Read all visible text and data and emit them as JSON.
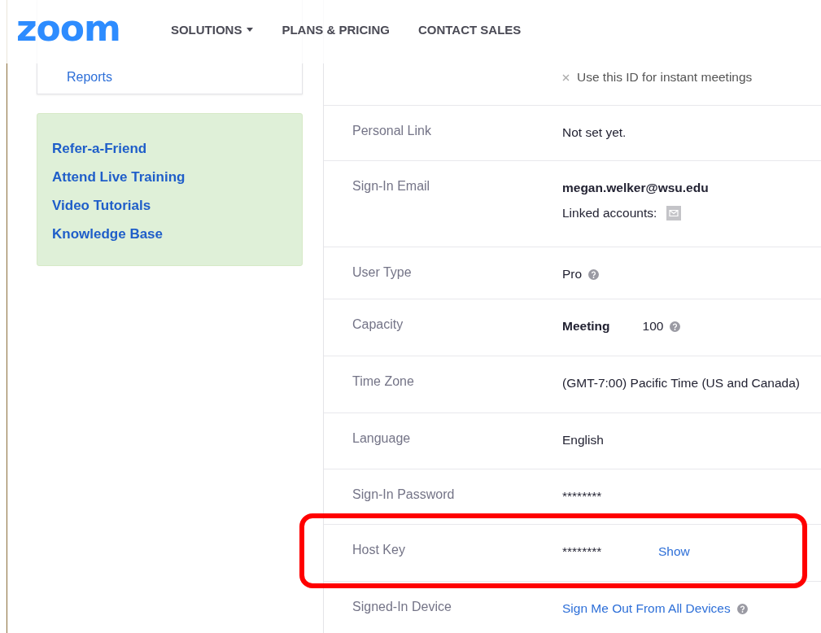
{
  "header": {
    "logo": "zoom",
    "nav": [
      {
        "label": "SOLUTIONS",
        "dropdown": true
      },
      {
        "label": "PLANS & PRICING",
        "dropdown": false
      },
      {
        "label": "CONTACT SALES",
        "dropdown": false
      }
    ]
  },
  "sidebar": {
    "items": [
      "Reports"
    ],
    "help_links": [
      "Refer-a-Friend",
      "Attend Live Training",
      "Video Tutorials",
      "Knowledge Base"
    ]
  },
  "profile_rows": [
    {
      "kind": "option",
      "option": {
        "label": "Use this ID for instant meetings",
        "checked": false
      },
      "highlighted": false
    },
    {
      "kind": "text",
      "label": "Personal Link",
      "value": "Not set yet.",
      "help": false,
      "highlighted": false
    },
    {
      "kind": "email",
      "label": "Sign-In Email",
      "value": "megan.welker@wsu.edu",
      "linked_label": "Linked accounts:",
      "highlighted": false
    },
    {
      "kind": "text",
      "label": "User Type",
      "value": "Pro",
      "help": true,
      "highlighted": false
    },
    {
      "kind": "capacity",
      "label": "Capacity",
      "name": "Meeting",
      "value": "100",
      "help": true,
      "highlighted": false
    },
    {
      "kind": "text",
      "label": "Time Zone",
      "value": "(GMT-7:00) Pacific Time (US and Canada)",
      "help": false,
      "highlighted": false
    },
    {
      "kind": "text",
      "label": "Language",
      "value": "English",
      "help": false,
      "highlighted": false
    },
    {
      "kind": "secret",
      "label": "Sign-In Password",
      "value": "********",
      "highlighted": false
    },
    {
      "kind": "secret",
      "label": "Host Key",
      "value": "********",
      "action": "Show",
      "highlighted": true
    },
    {
      "kind": "link",
      "label": "Signed-In Device",
      "value": "Sign Me Out From All Devices",
      "help": true,
      "highlighted": false
    }
  ]
}
